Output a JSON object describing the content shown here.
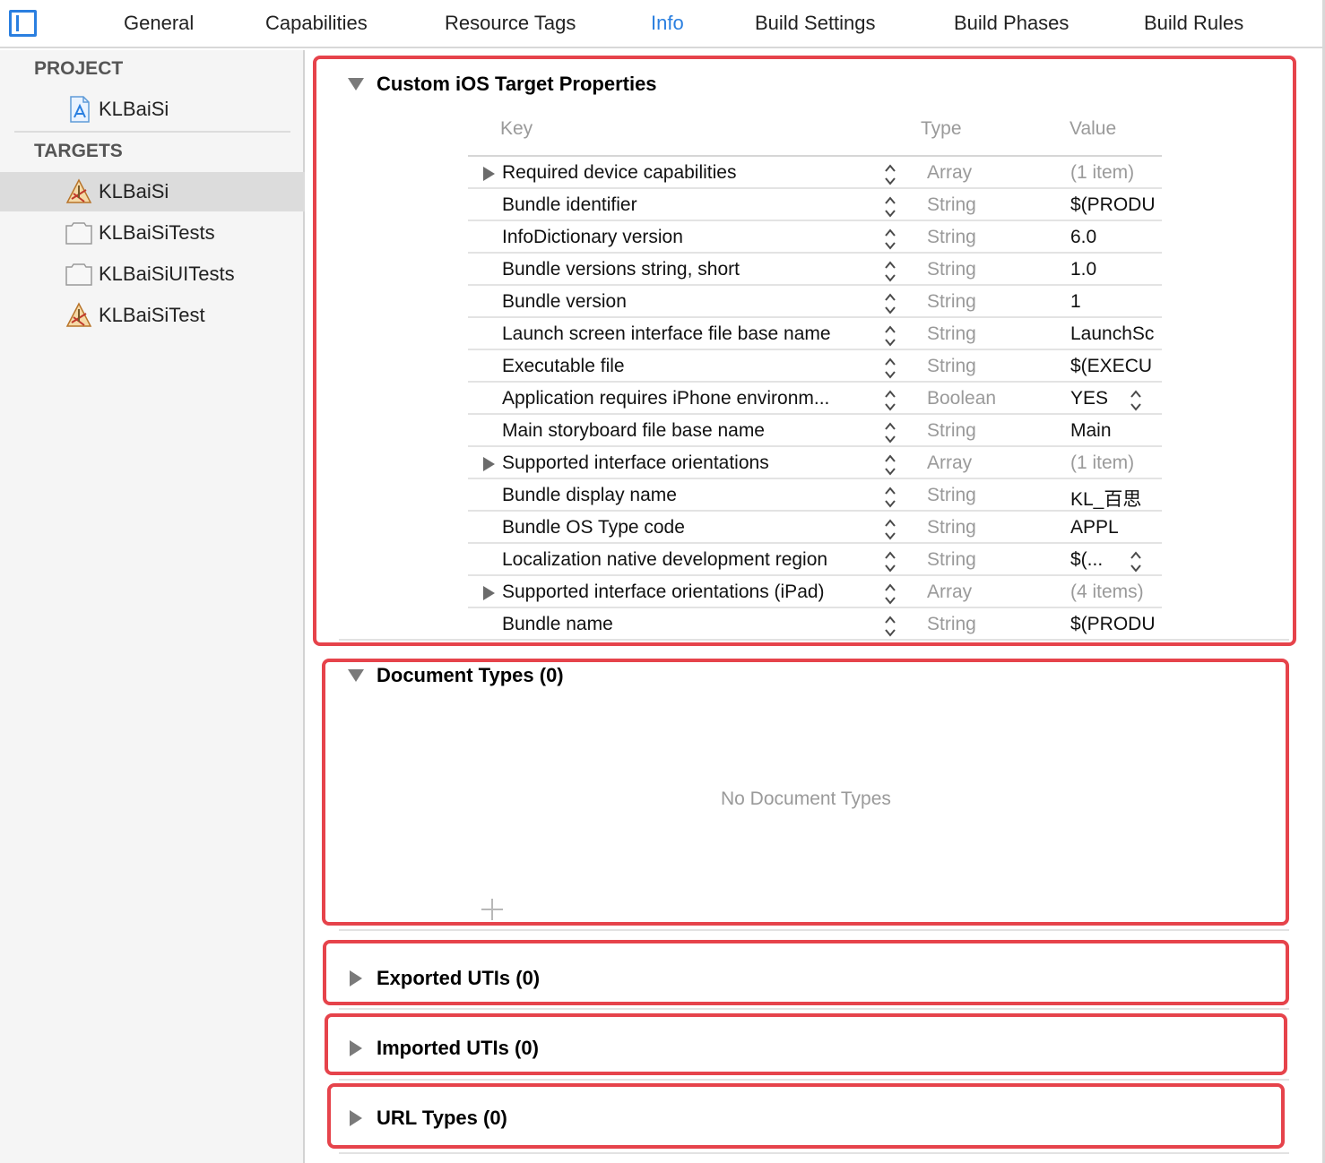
{
  "tabs": [
    "General",
    "Capabilities",
    "Resource Tags",
    "Info",
    "Build Settings",
    "Build Phases",
    "Build Rules"
  ],
  "active_tab": "Info",
  "sidebar": {
    "project_header": "PROJECT",
    "project_item": "KLBaiSi",
    "targets_header": "TARGETS",
    "targets": [
      "KLBaiSi",
      "KLBaiSiTests",
      "KLBaiSiUITests",
      "KLBaiSiTest"
    ],
    "selected_target": "KLBaiSi"
  },
  "custom_properties": {
    "title": "Custom iOS Target Properties",
    "columns": {
      "key": "Key",
      "type": "Type",
      "value": "Value"
    },
    "rows": [
      {
        "key": "Required device capabilities",
        "type": "Array",
        "value": "(1 item)",
        "expandable": true
      },
      {
        "key": "Bundle identifier",
        "type": "String",
        "value": "$(PRODU"
      },
      {
        "key": "InfoDictionary version",
        "type": "String",
        "value": "6.0"
      },
      {
        "key": "Bundle versions string, short",
        "type": "String",
        "value": "1.0"
      },
      {
        "key": "Bundle version",
        "type": "String",
        "value": "1"
      },
      {
        "key": "Launch screen interface file base name",
        "type": "String",
        "value": "LaunchSc"
      },
      {
        "key": "Executable file",
        "type": "String",
        "value": "$(EXECU"
      },
      {
        "key": "Application requires iPhone environm...",
        "type": "Boolean",
        "value": "YES",
        "value_stepper": true
      },
      {
        "key": "Main storyboard file base name",
        "type": "String",
        "value": "Main"
      },
      {
        "key": "Supported interface orientations",
        "type": "Array",
        "value": "(1 item)",
        "expandable": true
      },
      {
        "key": "Bundle display name",
        "type": "String",
        "value": "KL_百思"
      },
      {
        "key": "Bundle OS Type code",
        "type": "String",
        "value": "APPL"
      },
      {
        "key": "Localization native development region",
        "type": "String",
        "value": "$(...",
        "value_stepper": true
      },
      {
        "key": "Supported interface orientations (iPad)",
        "type": "Array",
        "value": "(4 items)",
        "expandable": true
      },
      {
        "key": "Bundle name",
        "type": "String",
        "value": "$(PRODU"
      }
    ]
  },
  "document_types": {
    "title": "Document Types (0)",
    "empty_message": "No Document Types"
  },
  "exported_utis": {
    "title": "Exported UTIs (0)"
  },
  "imported_utis": {
    "title": "Imported UTIs (0)"
  },
  "url_types": {
    "title": "URL Types (0)"
  },
  "colors": {
    "accent": "#2a7fe0",
    "highlight_border": "#e6434b",
    "muted_text": "#9a9a9a"
  }
}
